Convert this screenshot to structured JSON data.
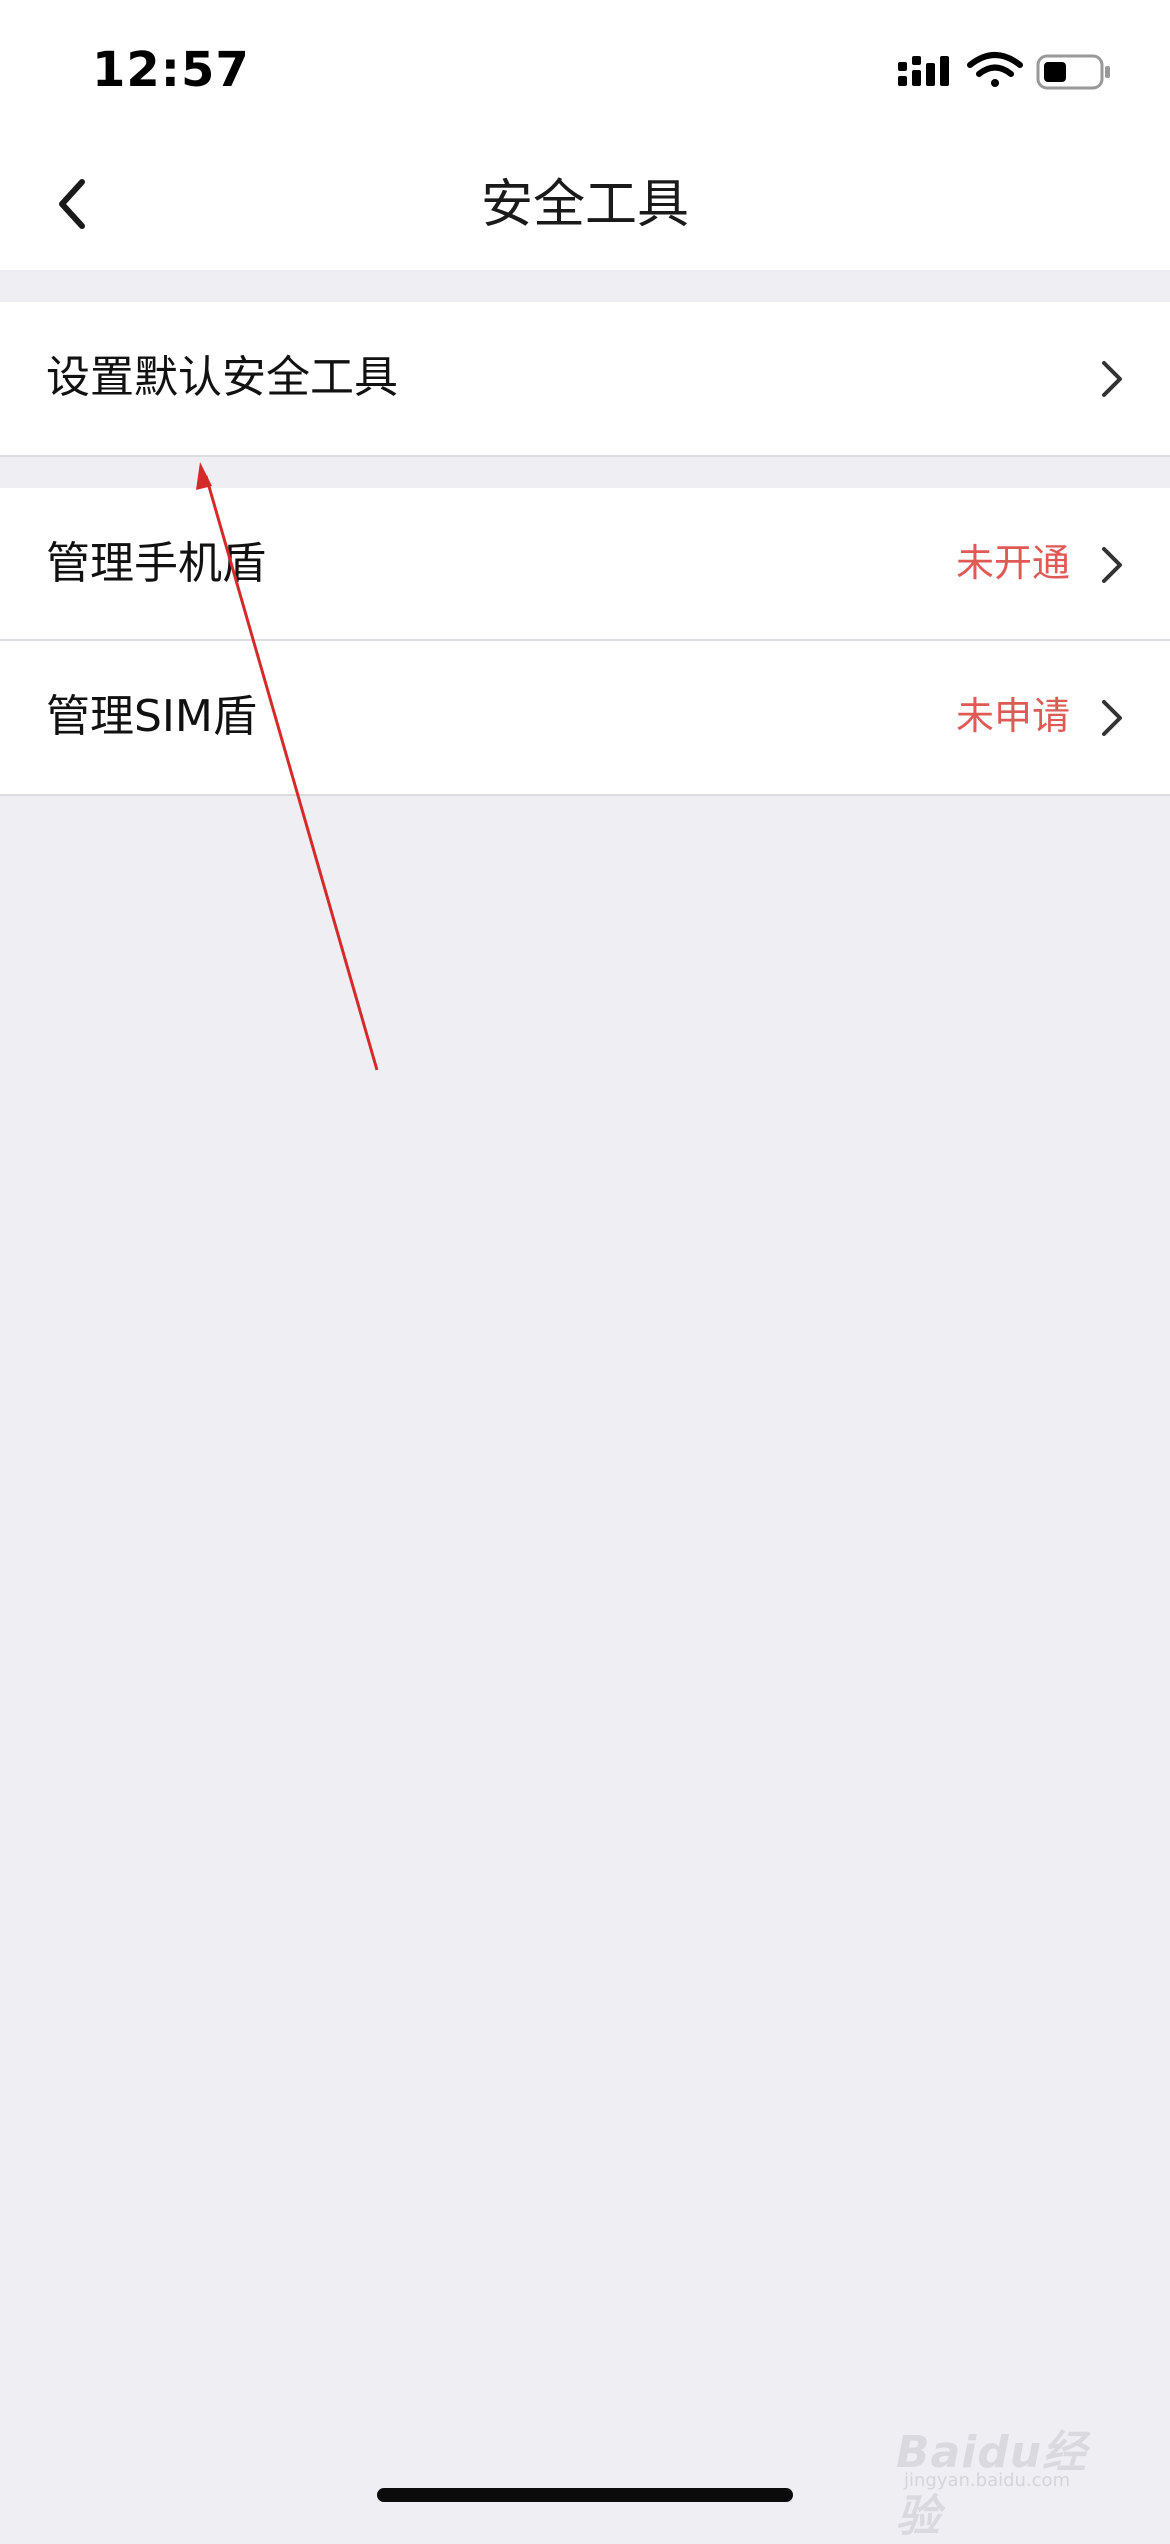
{
  "status_bar": {
    "time": "12:57",
    "icons": [
      "cellular-signal-icon",
      "wifi-icon",
      "battery-icon"
    ]
  },
  "nav": {
    "title": "安全工具",
    "back_icon": "chevron-left-icon"
  },
  "groups": [
    {
      "rows": [
        {
          "label": "设置默认安全工具",
          "status": ""
        }
      ]
    },
    {
      "rows": [
        {
          "label": "管理手机盾",
          "status": "未开通"
        },
        {
          "label": "管理SIM盾",
          "status": "未申请"
        }
      ]
    }
  ],
  "colors": {
    "background": "#efeef3",
    "surface": "#ffffff",
    "status_text": "#e05a55",
    "annotation_arrow": "#d42a2a"
  },
  "watermark": {
    "text": "Baidu经验",
    "sub": "jingyan.baidu.com"
  }
}
